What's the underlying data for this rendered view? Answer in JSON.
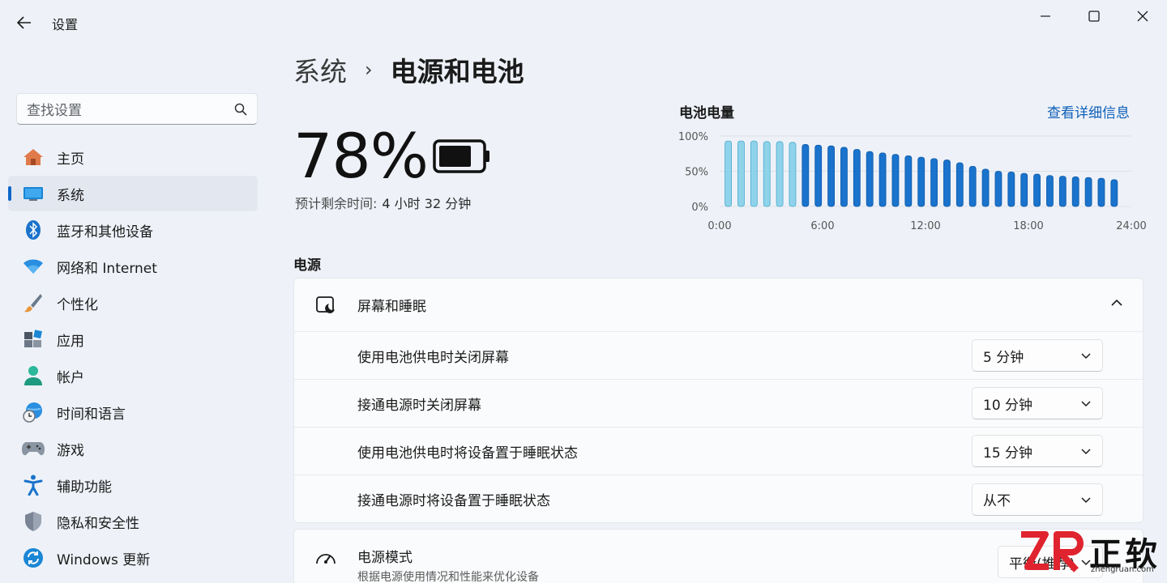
{
  "app": {
    "title": "设置"
  },
  "search": {
    "placeholder": "查找设置"
  },
  "sidebar": {
    "items": [
      {
        "label": "主页",
        "icon": "home-icon"
      },
      {
        "label": "系统",
        "icon": "system-icon",
        "active": true
      },
      {
        "label": "蓝牙和其他设备",
        "icon": "bluetooth-icon"
      },
      {
        "label": "网络和 Internet",
        "icon": "wifi-icon"
      },
      {
        "label": "个性化",
        "icon": "brush-icon"
      },
      {
        "label": "应用",
        "icon": "apps-icon"
      },
      {
        "label": "帐户",
        "icon": "account-icon"
      },
      {
        "label": "时间和语言",
        "icon": "globe-clock-icon"
      },
      {
        "label": "游戏",
        "icon": "gamepad-icon"
      },
      {
        "label": "辅助功能",
        "icon": "accessibility-icon"
      },
      {
        "label": "隐私和安全性",
        "icon": "shield-icon"
      },
      {
        "label": "Windows 更新",
        "icon": "update-icon"
      }
    ]
  },
  "breadcrumb": {
    "parent": "系统",
    "separator": "›",
    "current": "电源和电池"
  },
  "battery": {
    "percent_text": "78%",
    "level": 0.78,
    "remaining_label": "预计剩余时间:",
    "remaining_value": "4 小时 32 分钟"
  },
  "chart_panel": {
    "title": "电池电量",
    "link": "查看详细信息"
  },
  "chart_data": {
    "type": "bar",
    "title": "电池电量",
    "y_ticks": [
      "100%",
      "50%",
      "0%"
    ],
    "x_ticks": [
      "0:00",
      "6:00",
      "12:00",
      "18:00",
      "24:00"
    ],
    "ylim": [
      0,
      100
    ],
    "xlim": [
      0,
      24
    ],
    "bar_colors": {
      "charging": "#8fd3ea",
      "discharging": "#1a73cc"
    },
    "bars": [
      {
        "x": 0.5,
        "value": 93,
        "state": "charging"
      },
      {
        "x": 1.25,
        "value": 93,
        "state": "charging"
      },
      {
        "x": 2.0,
        "value": 93,
        "state": "charging"
      },
      {
        "x": 2.75,
        "value": 92,
        "state": "charging"
      },
      {
        "x": 3.5,
        "value": 92,
        "state": "charging"
      },
      {
        "x": 4.25,
        "value": 91,
        "state": "charging"
      },
      {
        "x": 5.0,
        "value": 88,
        "state": "discharging"
      },
      {
        "x": 5.75,
        "value": 87,
        "state": "discharging"
      },
      {
        "x": 6.5,
        "value": 86,
        "state": "discharging"
      },
      {
        "x": 7.25,
        "value": 84,
        "state": "discharging"
      },
      {
        "x": 8.0,
        "value": 81,
        "state": "discharging"
      },
      {
        "x": 8.75,
        "value": 78,
        "state": "discharging"
      },
      {
        "x": 9.5,
        "value": 76,
        "state": "discharging"
      },
      {
        "x": 10.25,
        "value": 74,
        "state": "discharging"
      },
      {
        "x": 11.0,
        "value": 72,
        "state": "discharging"
      },
      {
        "x": 11.75,
        "value": 70,
        "state": "discharging"
      },
      {
        "x": 12.5,
        "value": 68,
        "state": "discharging"
      },
      {
        "x": 13.25,
        "value": 66,
        "state": "discharging"
      },
      {
        "x": 14.0,
        "value": 62,
        "state": "discharging"
      },
      {
        "x": 14.75,
        "value": 57,
        "state": "discharging"
      },
      {
        "x": 15.5,
        "value": 53,
        "state": "discharging"
      },
      {
        "x": 16.25,
        "value": 50,
        "state": "discharging"
      },
      {
        "x": 17.0,
        "value": 49,
        "state": "discharging"
      },
      {
        "x": 17.75,
        "value": 47,
        "state": "discharging"
      },
      {
        "x": 18.5,
        "value": 46,
        "state": "discharging"
      },
      {
        "x": 19.25,
        "value": 44,
        "state": "discharging"
      },
      {
        "x": 20.0,
        "value": 43,
        "state": "discharging"
      },
      {
        "x": 20.75,
        "value": 42,
        "state": "discharging"
      },
      {
        "x": 21.5,
        "value": 41,
        "state": "discharging"
      },
      {
        "x": 22.25,
        "value": 40,
        "state": "discharging"
      },
      {
        "x": 23.0,
        "value": 38,
        "state": "discharging"
      }
    ],
    "grid": true
  },
  "power_section": {
    "title": "电源",
    "screen_sleep": {
      "title": "屏幕和睡眠",
      "rows": [
        {
          "label": "使用电池供电时关闭屏幕",
          "value": "5 分钟"
        },
        {
          "label": "接通电源时关闭屏幕",
          "value": "10 分钟"
        },
        {
          "label": "使用电池供电时将设备置于睡眠状态",
          "value": "15 分钟"
        },
        {
          "label": "接通电源时将设备置于睡眠状态",
          "value": "从不"
        }
      ]
    },
    "power_mode": {
      "title": "电源模式",
      "subtitle": "根据电源使用情况和性能来优化设备",
      "value": "平衡(推荐)"
    }
  },
  "watermark": {
    "brand_cn": "正软",
    "url": "zhengruan.com"
  },
  "colors": {
    "accent": "#0e67c8",
    "link": "#0e5fb8"
  }
}
